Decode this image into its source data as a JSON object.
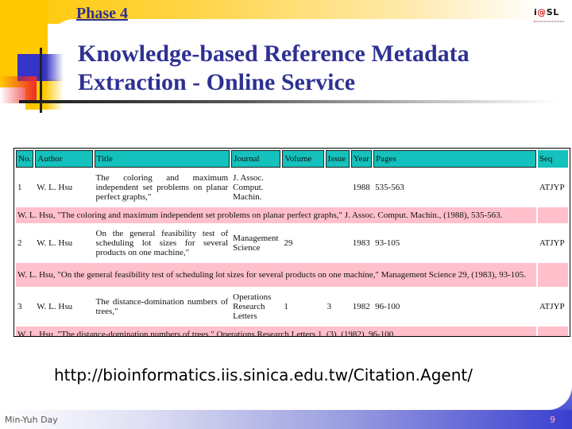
{
  "slide": {
    "phase": "Phase 4",
    "title_line1": "Knowledge-based Reference Metadata",
    "title_line2": "Extraction - Online Service",
    "logo": {
      "prefix": "i",
      "at": "@",
      "suffix": "SL"
    },
    "url": "http://bioinformatics.iis.sinica.edu.tw/Citation.Agent/",
    "footer_author": "Min-Yuh Day",
    "page_number": "9"
  },
  "table": {
    "headers": [
      "No.",
      "Author",
      "Title",
      "Journal",
      "Volume",
      "Issue",
      "Year",
      "Pages",
      "Seq"
    ],
    "rows": [
      {
        "no": "1",
        "author": "W. L. Hsu",
        "title": "The coloring and maximum independent set problems on planar perfect graphs,\"",
        "journal": "J. Assoc. Comput. Machin.",
        "volume": "",
        "issue": "",
        "year": "1988",
        "pages": "535-563",
        "seq": "ATJYP",
        "citation": "W. L. Hsu, \"The coloring and maximum independent set problems on planar perfect graphs,\" J. Assoc. Comput. Machin., (1988), 535-563."
      },
      {
        "no": "2",
        "author": "W. L. Hsu",
        "title": "On the general feasibility test of scheduling lot sizes for several products on one machine,\"",
        "journal": "Management Science",
        "volume": "29",
        "issue": "",
        "year": "1983",
        "pages": "93-105",
        "seq": "ATJYP",
        "citation": "W. L. Hsu, \"On the general feasibility test of scheduling lot sizes for several products on one machine,\" Management Science 29, (1983), 93-105."
      },
      {
        "no": "3",
        "author": "W. L. Hsu",
        "title": "The distance-domination numbers of trees,\"",
        "journal": "Operations Research Letters",
        "volume": "1",
        "issue": "3",
        "year": "1982",
        "pages": "96-100",
        "seq": "ATJYP",
        "citation": "W. L. Hsu, \"The distance-domination numbers of trees,\" Operations Research Letters 1, (3), (1982), 96-100."
      }
    ]
  },
  "colors": {
    "title": "#2e3192",
    "header_bg": "#14c1bc",
    "citation_bg": "#ffc0cb",
    "accent_yellow": "#ffc800",
    "accent_blue": "#3a3fd0"
  }
}
